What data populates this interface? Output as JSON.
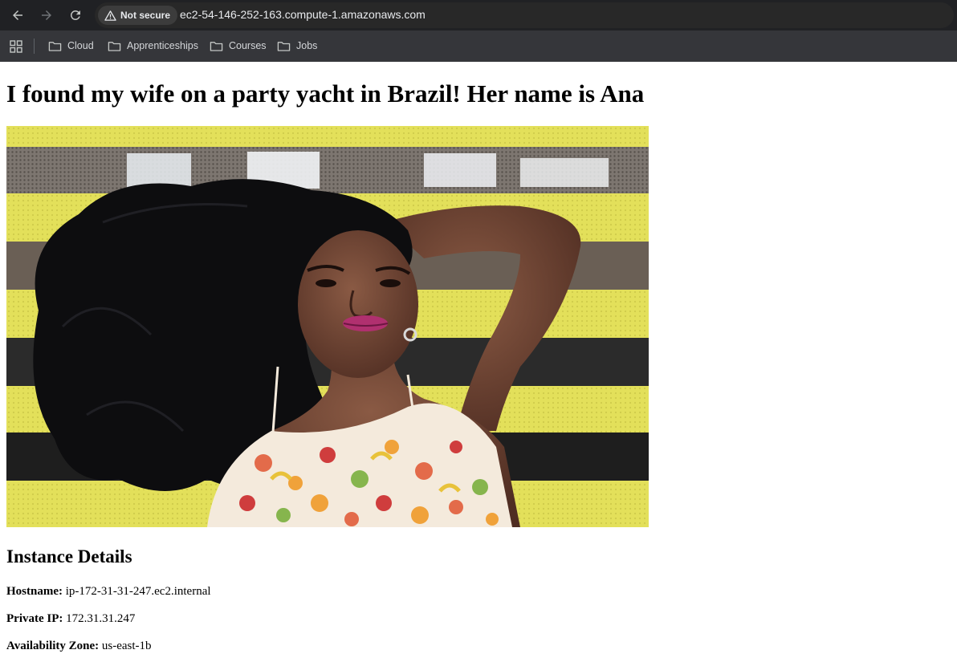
{
  "browser": {
    "security_label": "Not secure",
    "url": "ec2-54-146-252-163.compute-1.amazonaws.com",
    "bookmarks": [
      {
        "label": "Cloud",
        "icon": "folder-icon"
      },
      {
        "label": "Apprenticeships",
        "icon": "folder-icon"
      },
      {
        "label": "Courses",
        "icon": "folder-icon"
      },
      {
        "label": "Jobs",
        "icon": "folder-icon"
      }
    ]
  },
  "page": {
    "title": "I found my wife on a party yacht in Brazil! Her name is Ana",
    "image": {
      "alt": "Ana"
    },
    "section_title": "Instance Details",
    "details": [
      {
        "label": "Hostname:",
        "value": "ip-172-31-31-247.ec2.internal"
      },
      {
        "label": "Private IP:",
        "value": "172.31.31.247"
      },
      {
        "label": "Availability Zone:",
        "value": "us-east-1b"
      }
    ]
  },
  "colors": {
    "chrome_dark": "#202124",
    "bookmarks_bar": "#35363a",
    "stripe_yellow": "#e6e35c"
  }
}
